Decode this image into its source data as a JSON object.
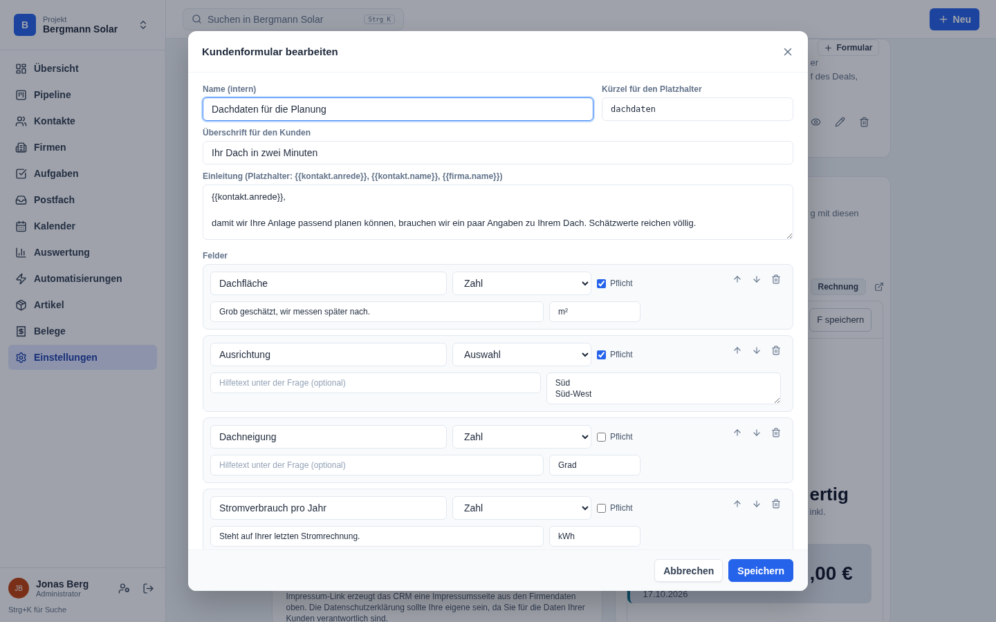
{
  "sidebar": {
    "logo_letter": "B",
    "project_label": "Projekt",
    "project_name": "Bergmann Solar",
    "items": [
      {
        "label": "Übersicht",
        "selected": false
      },
      {
        "label": "Pipeline",
        "selected": false
      },
      {
        "label": "Kontakte",
        "selected": false
      },
      {
        "label": "Firmen",
        "selected": false
      },
      {
        "label": "Aufgaben",
        "selected": false
      },
      {
        "label": "Postfach",
        "selected": false
      },
      {
        "label": "Kalender",
        "selected": false
      },
      {
        "label": "Auswertung",
        "selected": false
      },
      {
        "label": "Automatisierungen",
        "selected": false
      },
      {
        "label": "Artikel",
        "selected": false
      },
      {
        "label": "Belege",
        "selected": false
      },
      {
        "label": "Einstellungen",
        "selected": true
      }
    ],
    "user": {
      "initials": "JB",
      "name": "Jonas Berg",
      "role": "Administrator"
    },
    "search_hint": "Strg+K für Suche"
  },
  "header": {
    "search_placeholder": "Suchen in Bergmann Solar",
    "shortcut": "Strg K",
    "new_button": "Neu"
  },
  "background": {
    "forms_card": {
      "add_button": "Formular",
      "text_lines": [
        "er",
        "f des Deals,"
      ]
    },
    "invoice_card": {
      "text": "g mit diesen",
      "tab": "Rechnung",
      "save_button": "F speichern",
      "heading": "ertig",
      "subtext": "inkl.",
      "amount": ",00 €",
      "date": "17.10.2026"
    },
    "legal_note": "Impressum-Link erzeugt das CRM eine Impressumsseite aus den Firmendaten oben. Die Datenschutzerklärung sollte Ihre eigene sein, da Sie für die Daten Ihrer Kunden verantwortlich sind."
  },
  "dialog": {
    "title": "Kundenformular bearbeiten",
    "name": {
      "label": "Name (intern)",
      "value": "Dachdaten für die Planung",
      "focused": true
    },
    "slug": {
      "label": "Kürzel für den Platzhalter",
      "value": "dachdaten"
    },
    "heading": {
      "label": "Überschrift für den Kunden",
      "value": "Ihr Dach in zwei Minuten"
    },
    "intro": {
      "label": "Einleitung (Platzhalter: {{kontakt.anrede}}, {{kontakt.name}}, {{firma.name}})",
      "value": "{{kontakt.anrede}},\n\ndamit wir Ihre Anlage passend planen können, brauchen wir ein paar Angaben zu Ihrem Dach. Schätzwerte reichen völlig."
    },
    "fields_label": "Felder",
    "fields": [
      {
        "kind": "unit",
        "name": "Dachfläche",
        "type": "Zahl",
        "required": true,
        "required_label": "Pflicht",
        "help": "Grob geschätzt, wir messen später nach.",
        "unit": "m²"
      },
      {
        "kind": "options",
        "name": "Ausrichtung",
        "type": "Auswahl",
        "required": true,
        "required_label": "Pflicht",
        "help_placeholder": "Hilfetext unter der Frage (optional)",
        "options": "Süd\nSüd-West"
      },
      {
        "kind": "unit",
        "name": "Dachneigung",
        "type": "Zahl",
        "required": false,
        "required_label": "Pflicht",
        "help_placeholder": "Hilfetext unter der Frage (optional)",
        "unit": "Grad"
      },
      {
        "kind": "unit",
        "name": "Stromverbrauch pro Jahr",
        "type": "Zahl",
        "required": false,
        "required_label": "Pflicht",
        "help": "Steht auf Ihrer letzten Stromrechnung.",
        "unit": "kWh"
      }
    ],
    "buttons": [
      {
        "kind": "secondary",
        "label": "Abbrechen"
      },
      {
        "kind": "primary",
        "label": "Speichern"
      }
    ]
  }
}
